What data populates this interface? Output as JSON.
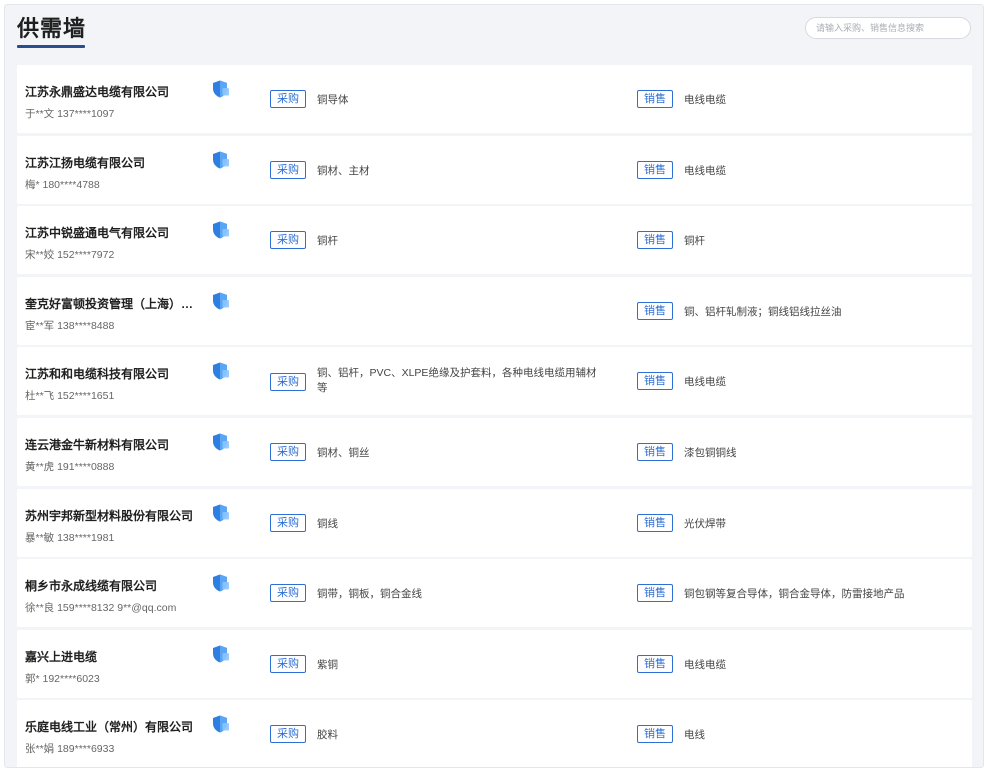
{
  "header": {
    "title": "供需墙",
    "search_placeholder": "请输入采购、销售信息搜索"
  },
  "labels": {
    "buy": "采购",
    "sell": "销售"
  },
  "colors": {
    "accent": "#2e6fd6",
    "title_underline": "#2a4d8f",
    "shield": "#2e7fe0"
  },
  "rows": [
    {
      "company": "江苏永鼎盛达电缆有限公司",
      "contact": "于**文 137****1097",
      "buy": "铜导体",
      "sell": "电线电缆"
    },
    {
      "company": "江苏江扬电缆有限公司",
      "contact": "梅* 180****4788",
      "buy": "铜材、主材",
      "sell": "电线电缆"
    },
    {
      "company": "江苏中锐盛通电气有限公司",
      "contact": "宋**姣 152****7972",
      "buy": "铜杆",
      "sell": "铜杆"
    },
    {
      "company": "奎克好富顿投资管理（上海）有限公司",
      "contact": "宦**军 138****8488",
      "buy": "",
      "sell": "铜、铝杆轧制液；铜线铝线拉丝油"
    },
    {
      "company": "江苏和和电缆科技有限公司",
      "contact": "杜**飞 152****1651",
      "buy": "铜、铝杆，PVC、XLPE绝缘及护套料，各种电线电缆用辅材等",
      "sell": "电线电缆"
    },
    {
      "company": "连云港金牛新材料有限公司",
      "contact": "黄**虎 191****0888",
      "buy": "铜材、铜丝",
      "sell": "漆包铜铜线"
    },
    {
      "company": "苏州宇邦新型材料股份有限公司",
      "contact": "暴**敏 138****1981",
      "buy": "铜线",
      "sell": "光伏焊带"
    },
    {
      "company": "桐乡市永成线缆有限公司",
      "contact": "徐**良 159****8132 9**@qq.com",
      "buy": "铜带，铜板，铜合金线",
      "sell": "铜包钢等复合导体，铜合金导体，防雷接地产品"
    },
    {
      "company": "嘉兴上进电缆",
      "contact": "郭* 192****6023",
      "buy": "紫铜",
      "sell": "电线电缆"
    },
    {
      "company": "乐庭电线工业（常州）有限公司",
      "contact": "张**娟 189****6933",
      "buy": "胶料",
      "sell": "电线"
    }
  ]
}
